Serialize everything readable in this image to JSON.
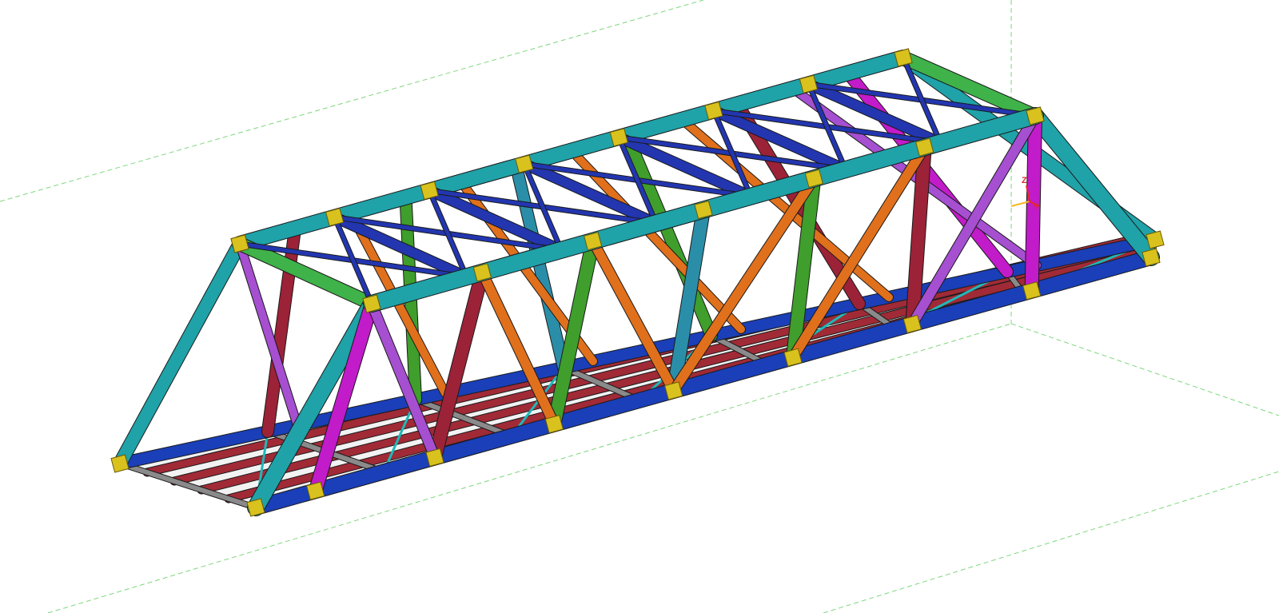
{
  "viewport": {
    "background": "#ffffff",
    "grid_line_color": "#7fd67f"
  },
  "model": {
    "kind": "steel truss bridge",
    "render_style": "shaded members with connection plates"
  },
  "axis_triad": {
    "z_label": "Z",
    "y_label": "Y",
    "x_color": "#f5b820",
    "y_color": "#e02a2a",
    "z_color": "#e02a2a"
  },
  "member_colors": {
    "top_chord": "#1fa2a8",
    "end_post": "#1fa2a8",
    "bottom_chord": "#1a3fb8",
    "top_lateral_strut": "#2336b0",
    "portal_beam": "#3fb24a",
    "verticals_magenta": "#c21bc9",
    "diagonals_violet": "#a64fd1",
    "diagonals_orange": "#e0701c",
    "verticals_green": "#3f9e2c",
    "verticals_teal": "#2b8ea8",
    "verticals_maroon": "#9c2238",
    "stringers": "#a02a36",
    "floor_laterals": "#1fb8b8",
    "gusset_plates": "#d9c21e",
    "deck_plates": "#8a8a8a"
  }
}
